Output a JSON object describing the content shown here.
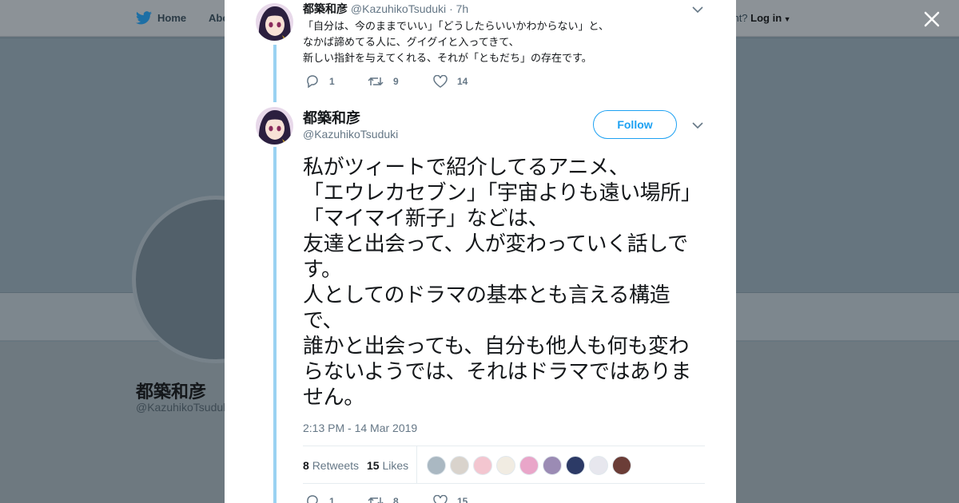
{
  "background": {
    "nav": {
      "home_label": "Home",
      "about_label": "Abo",
      "account_prompt": "ccount?",
      "login_label": "Log in"
    },
    "profile": {
      "name": "都築和彦",
      "handle": "@KazuhikoTsuduk"
    }
  },
  "parent_tweet": {
    "name": "都築和彦",
    "handle": "@KazuhikoTsuduki",
    "time": "· 7h",
    "text": "「自分は、今のままでいい」「どうしたらいいかわからない」と、\nなかば諦めてる人に、グイグイと入ってきて、\n新しい指針を与えてくれる、それが「ともだち」の存在です。",
    "replies": "1",
    "retweets": "9",
    "likes": "14"
  },
  "main_tweet": {
    "name": "都築和彦",
    "handle": "@KazuhikoTsuduki",
    "follow_label": "Follow",
    "text": "私がツィートで紹介してるアニメ、\n「エウレカセブン」「宇宙よりも遠い場所」「マイマイ新子」などは、\n友達と出会って、人が変わっていく話しです。\n人としてのドラマの基本とも言える構造で、\n誰かと出会っても、自分も他人も何も変わらないようでは、それはドラマではありません。",
    "timestamp": "2:13 PM - 14 Mar 2019",
    "retweet_count": "8",
    "retweets_label": "Retweets",
    "like_count": "15",
    "likes_label": "Likes",
    "likers": [
      {
        "icon": "default-avatar",
        "color": "#aab8c2"
      },
      {
        "icon": "anime-avatar",
        "color": "#d9d3cc"
      },
      {
        "icon": "anime-avatar",
        "color": "#f3c6d0"
      },
      {
        "icon": "anime-avatar",
        "color": "#f1ece2"
      },
      {
        "icon": "anime-avatar",
        "color": "#e9a6c9"
      },
      {
        "icon": "anime-avatar",
        "color": "#9b8bb4"
      },
      {
        "icon": "anime-avatar",
        "color": "#2c3a66"
      },
      {
        "icon": "anime-avatar",
        "color": "#e7e7ee"
      },
      {
        "icon": "anime-avatar",
        "color": "#6b3d37"
      }
    ],
    "replies": "1",
    "retweets": "8",
    "likes": "15"
  },
  "colors": {
    "accent": "#1da1f2",
    "thread_line": "#9ad2f2",
    "text": "#14171a",
    "muted": "#657786",
    "overlay": "#66757f"
  }
}
